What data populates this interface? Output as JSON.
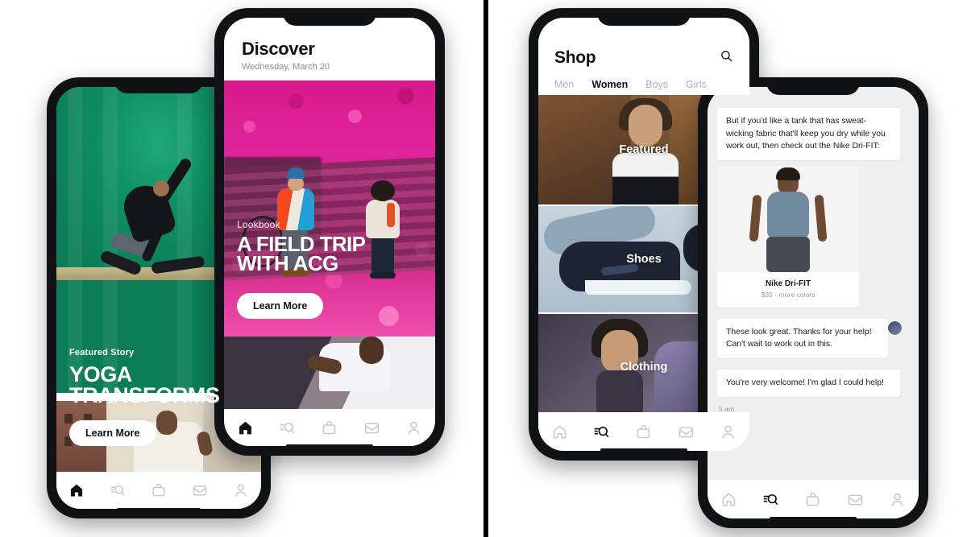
{
  "panels": {
    "left_label": "left-panel",
    "right_label": "right-panel"
  },
  "phone_yoga": {
    "kicker": "Featured Story",
    "title_line1": "YOGA",
    "title_line2": "TRANSFORMS",
    "cta": "Learn More",
    "nav": [
      {
        "icon": "home-icon",
        "label": "Home",
        "active": true
      },
      {
        "icon": "search-icon",
        "label": "Search",
        "active": false
      },
      {
        "icon": "bag-icon",
        "label": "Shop",
        "active": false
      },
      {
        "icon": "inbox-icon",
        "label": "Inbox",
        "active": false
      },
      {
        "icon": "profile-icon",
        "label": "Profile",
        "active": false
      }
    ]
  },
  "phone_discover": {
    "title": "Discover",
    "date": "Wednesday, March 20",
    "card": {
      "kicker": "Lookbook",
      "title_line1": "A FIELD TRIP",
      "title_line2": "WITH ACG",
      "cta": "Learn More"
    },
    "nav": [
      {
        "icon": "home-icon",
        "label": "Home",
        "active": true
      },
      {
        "icon": "search-icon",
        "label": "Search",
        "active": false
      },
      {
        "icon": "bag-icon",
        "label": "Shop",
        "active": false
      },
      {
        "icon": "inbox-icon",
        "label": "Inbox",
        "active": false
      },
      {
        "icon": "profile-icon",
        "label": "Profile",
        "active": false
      }
    ]
  },
  "phone_shop": {
    "title": "Shop",
    "search_icon": "search-icon",
    "tabs": [
      {
        "label": "Men",
        "active": false
      },
      {
        "label": "Women",
        "active": true
      },
      {
        "label": "Boys",
        "active": false
      },
      {
        "label": "Girls",
        "active": false
      }
    ],
    "categories": [
      {
        "label": "Featured"
      },
      {
        "label": "Shoes"
      },
      {
        "label": "Clothing"
      }
    ],
    "nav": [
      {
        "icon": "home-icon",
        "label": "Home",
        "active": false
      },
      {
        "icon": "search-icon",
        "label": "Search",
        "active": true
      },
      {
        "icon": "bag-icon",
        "label": "Shop",
        "active": false
      },
      {
        "icon": "inbox-icon",
        "label": "Inbox",
        "active": false
      },
      {
        "icon": "profile-icon",
        "label": "Profile",
        "active": false
      }
    ]
  },
  "phone_chat": {
    "messages": [
      {
        "from": "agent",
        "text": "But if you'd like a tank that has sweat-wicking fabric that'll keep you dry while you work out, then check out the Nike Dri-FIT:"
      },
      {
        "from": "user",
        "text": "These look great. Thanks for your help! Can't wait to work out in this."
      },
      {
        "from": "agent",
        "text": "You're very welcome! I'm glad I could help!"
      }
    ],
    "product": {
      "name": "Nike Dri-FIT",
      "price": "$35 - more colors"
    },
    "timestamp": "5 am",
    "nav": [
      {
        "icon": "home-icon",
        "label": "Home",
        "active": false
      },
      {
        "icon": "search-icon",
        "label": "Search",
        "active": true
      },
      {
        "icon": "bag-icon",
        "label": "Shop",
        "active": false
      },
      {
        "icon": "inbox-icon",
        "label": "Inbox",
        "active": false
      },
      {
        "icon": "profile-icon",
        "label": "Profile",
        "active": false
      }
    ]
  },
  "colors": {
    "yoga_green": "#0f8f63",
    "acg_pink": "#d8198d",
    "divider": "#000000",
    "active_nav": "#111111",
    "inactive_nav": "#c9c9c9"
  }
}
